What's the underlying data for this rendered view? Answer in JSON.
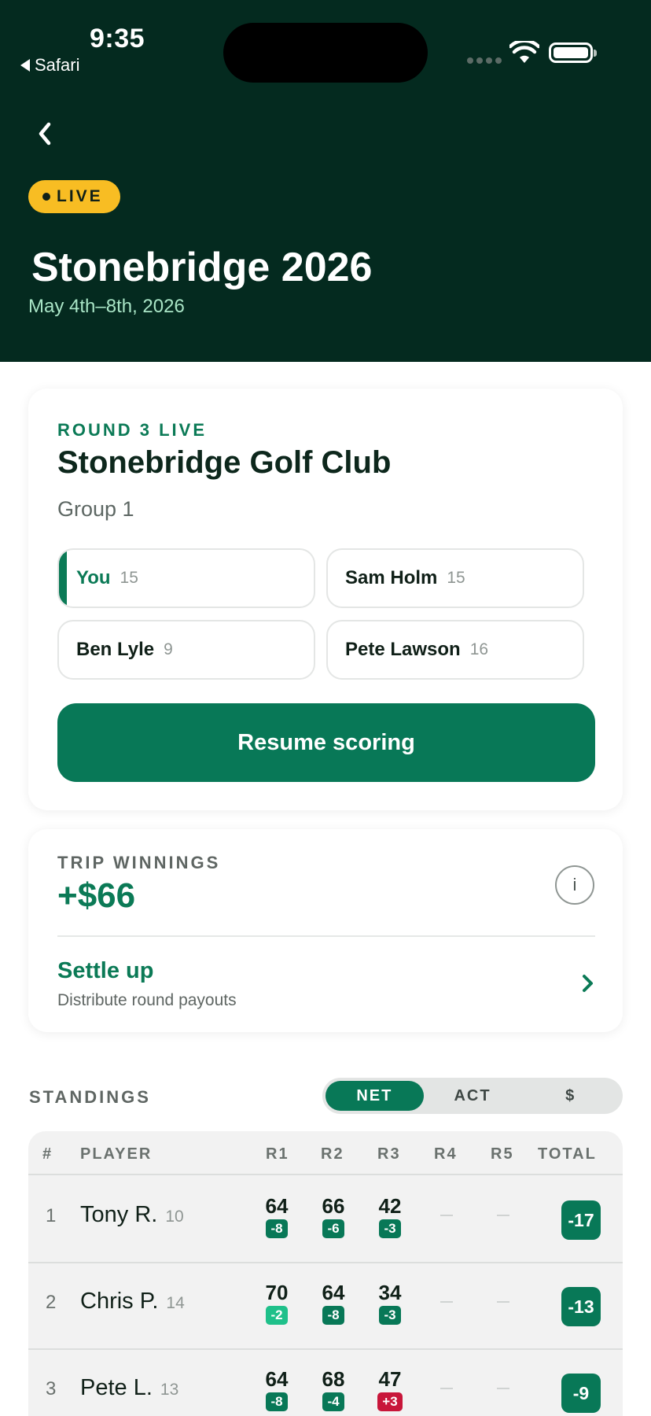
{
  "status_bar": {
    "time": "9:35",
    "back_app": "Safari"
  },
  "header": {
    "live_label": "LIVE",
    "title": "Stonebridge 2026",
    "dates": "May 4th–8th, 2026"
  },
  "round_card": {
    "round_label": "ROUND 3 LIVE",
    "course": "Stonebridge Golf Club",
    "group": "Group 1",
    "players": [
      {
        "name": "You",
        "handicap": "15",
        "active": true
      },
      {
        "name": "Sam Holm",
        "handicap": "15",
        "active": false
      },
      {
        "name": "Ben Lyle",
        "handicap": "9",
        "active": false
      },
      {
        "name": "Pete Lawson",
        "handicap": "16",
        "active": false
      }
    ],
    "resume_label": "Resume scoring"
  },
  "winnings_card": {
    "label": "TRIP WINNINGS",
    "amount": "+$66",
    "info": "i",
    "settle_title": "Settle up",
    "settle_sub": "Distribute round payouts"
  },
  "standings": {
    "label": "STANDINGS",
    "tabs": [
      "NET",
      "ACT",
      "$"
    ],
    "active_tab": "NET",
    "headers": {
      "rank": "#",
      "player": "PLAYER",
      "r1": "R1",
      "r2": "R2",
      "r3": "R3",
      "r4": "R4",
      "r5": "R5",
      "total": "TOTAL"
    },
    "rows": [
      {
        "rank": "1",
        "name": "Tony R.",
        "hcp": "10",
        "rounds": [
          {
            "score": "64",
            "topar": "-8",
            "tone": "dark"
          },
          {
            "score": "66",
            "topar": "-6",
            "tone": "dark"
          },
          {
            "score": "42",
            "topar": "-3",
            "tone": "dark"
          },
          null,
          null
        ],
        "total": "-17"
      },
      {
        "rank": "2",
        "name": "Chris P.",
        "hcp": "14",
        "rounds": [
          {
            "score": "70",
            "topar": "-2",
            "tone": "light"
          },
          {
            "score": "64",
            "topar": "-8",
            "tone": "dark"
          },
          {
            "score": "34",
            "topar": "-3",
            "tone": "dark"
          },
          null,
          null
        ],
        "total": "-13"
      },
      {
        "rank": "3",
        "name": "Pete L.",
        "hcp": "13",
        "rounds": [
          {
            "score": "64",
            "topar": "-8",
            "tone": "dark"
          },
          {
            "score": "68",
            "topar": "-4",
            "tone": "dark"
          },
          {
            "score": "47",
            "topar": "+3",
            "tone": "over"
          },
          null,
          null
        ],
        "total": "-9"
      }
    ]
  },
  "colors": {
    "header_bg": "#042a1f",
    "accent": "#087857",
    "live": "#f8bd23",
    "over_par": "#c8163a"
  }
}
